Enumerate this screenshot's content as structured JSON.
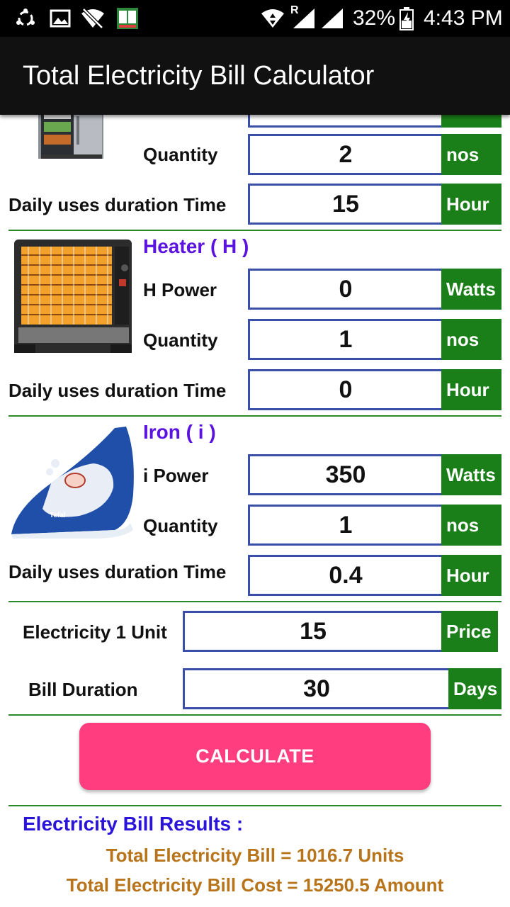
{
  "status_bar": {
    "battery": "32%",
    "time": "4:43 PM",
    "network_badge": "R"
  },
  "app_bar": {
    "title": "Total Electricity Bill Calculator"
  },
  "fridge": {
    "quantity_label": "Quantity",
    "quantity": "2",
    "quantity_unit": "nos",
    "duration_label": "Daily uses duration Time",
    "duration": "15",
    "duration_unit": "Hour"
  },
  "heater": {
    "title": "Heater ( H )",
    "power_label": "H Power",
    "power": "0",
    "power_unit": "Watts",
    "quantity_label": "Quantity",
    "quantity": "1",
    "quantity_unit": "nos",
    "duration_label": "Daily uses duration Time",
    "duration": "0",
    "duration_unit": "Hour"
  },
  "iron": {
    "title": "Iron ( i )",
    "power_label": "i Power",
    "power": "350",
    "power_unit": "Watts",
    "quantity_label": "Quantity",
    "quantity": "1",
    "quantity_unit": "nos",
    "duration_label": "Daily uses duration Time",
    "duration": "0.4",
    "duration_unit": "Hour",
    "brand_text": "Tefal"
  },
  "rate": {
    "unit_label": "Electricity 1 Unit",
    "unit_price": "15",
    "unit_price_unit": "Price",
    "bill_duration_label": "Bill Duration",
    "bill_duration": "30",
    "bill_duration_unit": "Days"
  },
  "calculate_button": "CALCULATE",
  "results": {
    "title": "Electricity Bill Results :",
    "total_units": "Total Electricity Bill = 1016.7 Units",
    "total_cost": "Total Electricity Bill Cost = 15250.5 Amount"
  },
  "colors": {
    "unit_badge": "#1b7f19",
    "field_border": "#3a4fa8",
    "section_title": "#5b13e0",
    "button": "#ff3d7f",
    "results_title": "#2a14d9",
    "result_text": "#b8741a"
  }
}
